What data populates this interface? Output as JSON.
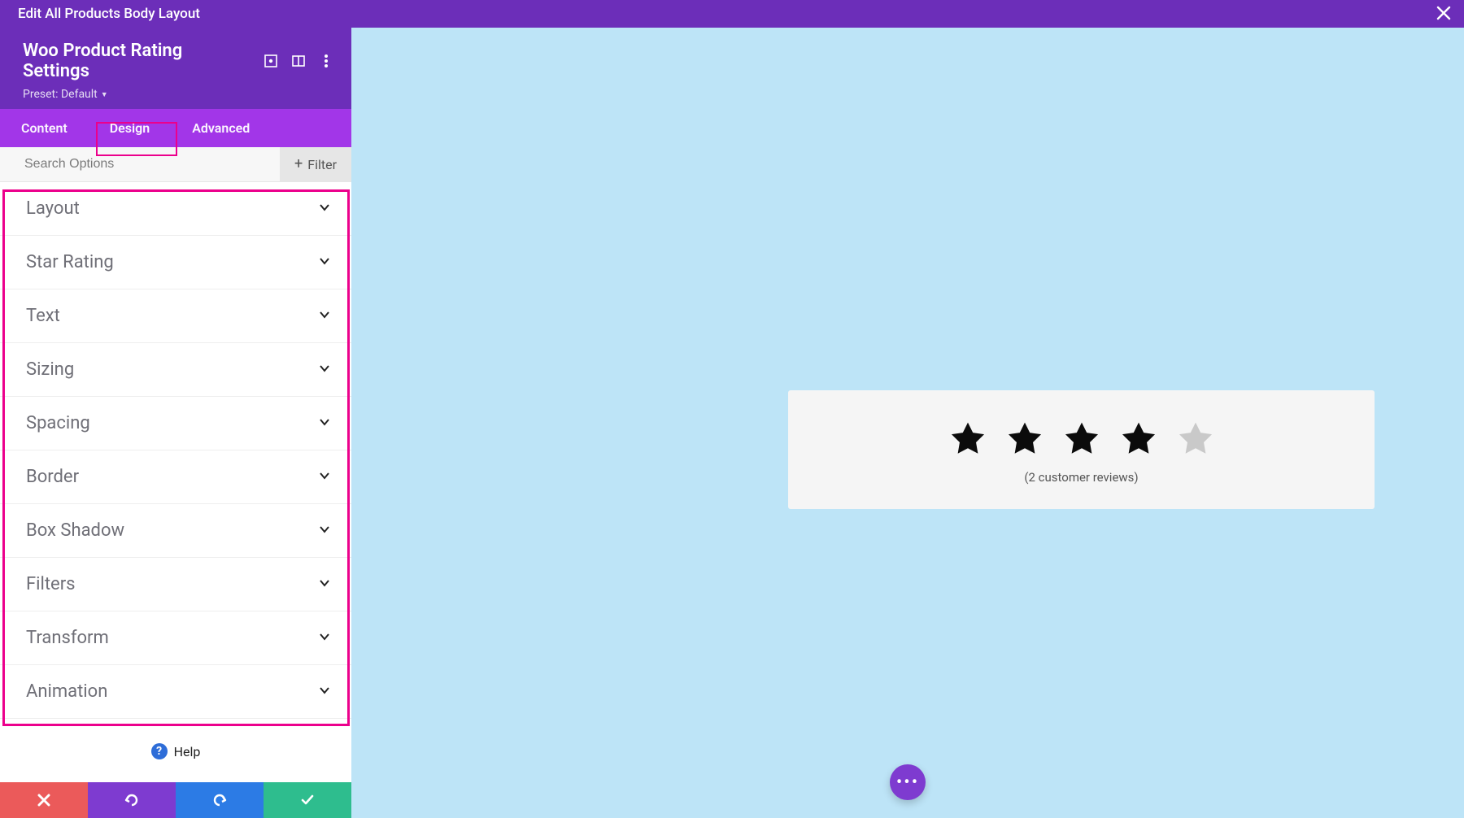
{
  "topbar": {
    "title": "Edit All Products Body Layout"
  },
  "panel": {
    "title": "Woo Product Rating Settings",
    "preset_label": "Preset: Default"
  },
  "tabs": {
    "items": [
      "Content",
      "Design",
      "Advanced"
    ],
    "active_index": 1
  },
  "search": {
    "placeholder": "Search Options",
    "filter_label": "Filter"
  },
  "sections": [
    {
      "label": "Layout"
    },
    {
      "label": "Star Rating"
    },
    {
      "label": "Text"
    },
    {
      "label": "Sizing"
    },
    {
      "label": "Spacing"
    },
    {
      "label": "Border"
    },
    {
      "label": "Box Shadow"
    },
    {
      "label": "Filters"
    },
    {
      "label": "Transform"
    },
    {
      "label": "Animation"
    }
  ],
  "help": {
    "label": "Help"
  },
  "preview": {
    "rating_filled": 4,
    "rating_total": 5,
    "reviews_text": "(2 customer reviews)"
  },
  "colors": {
    "primary": "#6c2eb9",
    "tabs_bg": "#a236e8",
    "highlight": "#ec008c",
    "canvas": "#bde4f7",
    "cancel": "#eb5a5a",
    "undo": "#7e3bd0",
    "redo": "#2c7be5",
    "save": "#2ebd8e"
  }
}
